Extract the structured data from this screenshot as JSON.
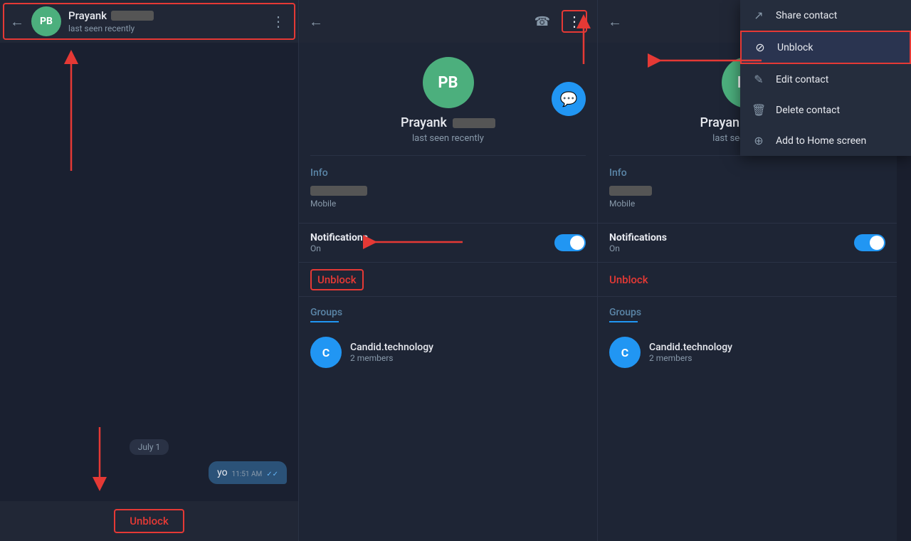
{
  "chat": {
    "back_label": "←",
    "avatar_initials": "PB",
    "contact_name": "Prayank",
    "contact_status": "last seen recently",
    "more_icon": "⋮",
    "date_label": "July 1",
    "message_text": "yo",
    "message_time": "11:51 AM",
    "unblock_btn": "Unblock"
  },
  "contact_panel": {
    "back_label": "←",
    "avatar_initials": "PB",
    "contact_name": "Prayank",
    "contact_status": "last seen recently",
    "phone_icon": "☎",
    "more_icon": "⋮",
    "info_label": "Info",
    "phone_type": "Mobile",
    "notifications_label": "Notifications",
    "notifications_status": "On",
    "unblock_label": "Unblock",
    "groups_label": "Groups",
    "group_name": "Candid.technology",
    "group_members": "2 members",
    "group_avatar": "C",
    "chat_icon": "💬"
  },
  "dropdown": {
    "share_contact": "Share contact",
    "unblock": "Unblock",
    "edit_contact": "Edit contact",
    "delete_contact": "Delete contact",
    "add_home": "Add to Home screen"
  }
}
